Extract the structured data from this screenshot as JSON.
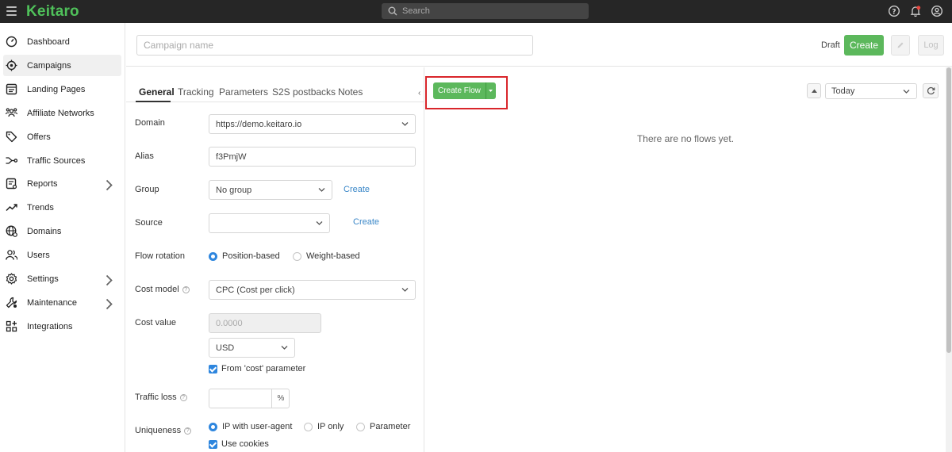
{
  "app": {
    "logo": "Keitaro"
  },
  "search": {
    "placeholder": "Search"
  },
  "sidebar": {
    "items": [
      {
        "label": "Dashboard"
      },
      {
        "label": "Campaigns"
      },
      {
        "label": "Landing Pages"
      },
      {
        "label": "Affiliate Networks"
      },
      {
        "label": "Offers"
      },
      {
        "label": "Traffic Sources"
      },
      {
        "label": "Reports"
      },
      {
        "label": "Trends"
      },
      {
        "label": "Domains"
      },
      {
        "label": "Users"
      },
      {
        "label": "Settings"
      },
      {
        "label": "Maintenance"
      },
      {
        "label": "Integrations"
      }
    ]
  },
  "header": {
    "campaign_name_placeholder": "Campaign name",
    "status": "Draft",
    "create_label": "Create",
    "log_label": "Log"
  },
  "tabs": [
    "General",
    "Tracking",
    "Parameters",
    "S2S postbacks",
    "Notes"
  ],
  "form": {
    "domain": {
      "label": "Domain",
      "value": "https://demo.keitaro.io"
    },
    "alias": {
      "label": "Alias",
      "value": "f3PmjW"
    },
    "group": {
      "label": "Group",
      "value": "No group",
      "link": "Create"
    },
    "source": {
      "label": "Source",
      "value": "",
      "link": "Create"
    },
    "flow_rotation": {
      "label": "Flow rotation",
      "options": [
        "Position-based",
        "Weight-based"
      ]
    },
    "cost_model": {
      "label": "Cost model",
      "value": "CPC (Cost per click)"
    },
    "cost_value": {
      "label": "Cost value",
      "placeholder": "0.0000",
      "currency": "USD",
      "from_cost_param": "From 'cost' parameter"
    },
    "traffic_loss": {
      "label": "Traffic loss",
      "unit": "%"
    },
    "uniqueness": {
      "label": "Uniqueness",
      "options": [
        "IP with user-agent",
        "IP only",
        "Parameter"
      ],
      "use_cookies": "Use cookies"
    }
  },
  "flows": {
    "create_flow_label": "Create Flow",
    "date_range": "Today",
    "empty_message": "There are no flows yet."
  },
  "colors": {
    "accent_green": "#5cb85c",
    "logo_green": "#4fc05a",
    "link_blue": "#3a87c8",
    "highlight_red": "#d9262b",
    "topbar": "#262626"
  }
}
